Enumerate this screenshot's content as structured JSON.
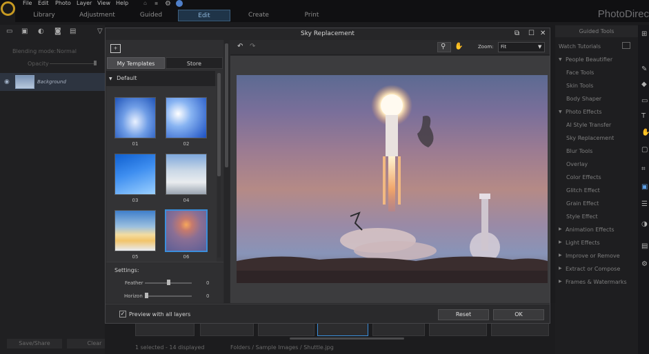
{
  "menu": {
    "items": [
      "File",
      "Edit",
      "Photo",
      "Layer",
      "View",
      "Help"
    ]
  },
  "modes": {
    "tabs": [
      "Library",
      "Adjustment",
      "Guided",
      "Edit",
      "Create",
      "Print"
    ],
    "active": "Edit"
  },
  "brand": "PhotoDirec",
  "layers": {
    "blending_label": "Blending mode:",
    "blending_value": "Normal",
    "opacity_label": "Opacity",
    "layer_name": "Background",
    "save_share": "Save/Share",
    "clear": "Clear"
  },
  "guided_tools": {
    "header": "Guided Tools",
    "watch_tutorials": "Watch Tutorials",
    "categories": [
      {
        "name": "People Beautifier",
        "expanded": true,
        "items": [
          "Face Tools",
          "Skin Tools",
          "Body Shaper"
        ]
      },
      {
        "name": "Photo Effects",
        "expanded": true,
        "items": [
          "AI Style Transfer",
          "Sky Replacement",
          "Blur Tools",
          "Overlay",
          "Color Effects",
          "Glitch Effect",
          "Grain Effect",
          "Style Effect"
        ]
      },
      {
        "name": "Animation Effects",
        "expanded": false,
        "items": []
      },
      {
        "name": "Light Effects",
        "expanded": false,
        "items": []
      },
      {
        "name": "Improve or Remove",
        "expanded": false,
        "items": []
      },
      {
        "name": "Extract or Compose",
        "expanded": false,
        "items": []
      },
      {
        "name": "Frames & Watermarks",
        "expanded": false,
        "items": []
      }
    ]
  },
  "status": {
    "selected": "1 selected - 14 displayed",
    "path": "Folders / Sample Images / Shuttle.jpg"
  },
  "dialog": {
    "title": "Sky Replacement",
    "tabs": [
      "My Templates",
      "Store"
    ],
    "group": "Default",
    "templates": [
      "01",
      "02",
      "03",
      "04",
      "05",
      "06"
    ],
    "selected_template": "06",
    "settings": {
      "title": "Settings:",
      "feather_label": "Feather",
      "feather_value": "0",
      "horizon_label": "Horizon",
      "horizon_value": "0"
    },
    "zoom_label": "Zoom:",
    "zoom_value": "Fit",
    "preview_all_layers": "Preview with all layers",
    "reset": "Reset",
    "ok": "OK"
  },
  "colors": {
    "accent": "#3b8fdc",
    "active_tab_bg": "#1f3448"
  }
}
